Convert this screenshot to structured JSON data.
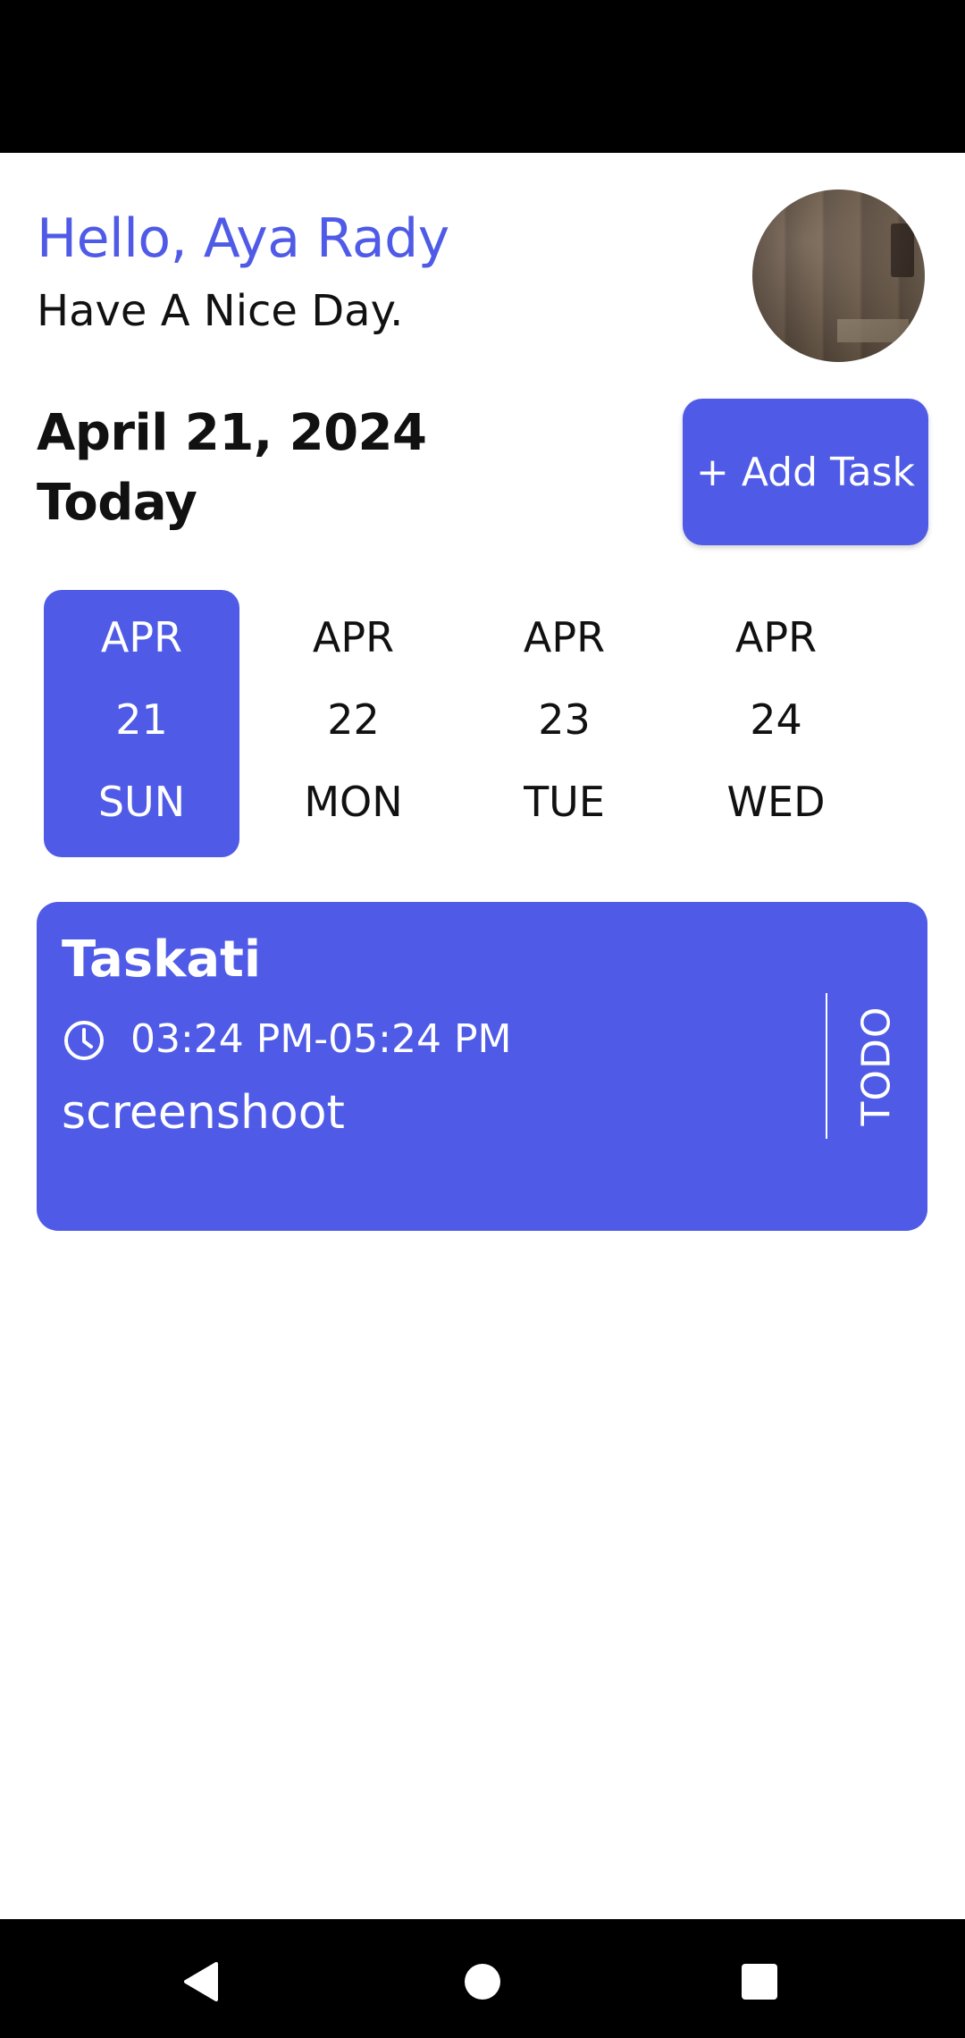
{
  "header": {
    "greeting": "Hello, Aya Rady",
    "subtitle": "Have A Nice Day."
  },
  "date_section": {
    "date": "April 21, 2024",
    "label": "Today",
    "add_task_label": "+ Add Task"
  },
  "days": [
    {
      "month": "APR",
      "day": "21",
      "weekday": "SUN",
      "selected": true
    },
    {
      "month": "APR",
      "day": "22",
      "weekday": "MON",
      "selected": false
    },
    {
      "month": "APR",
      "day": "23",
      "weekday": "TUE",
      "selected": false
    },
    {
      "month": "APR",
      "day": "24",
      "weekday": "WED",
      "selected": false
    }
  ],
  "task": {
    "title": "Taskati",
    "time": "03:24 PM-05:24 PM",
    "description": "screenshoot",
    "status": "TODO"
  },
  "colors": {
    "accent": "#4F5BE7",
    "text": "#111111",
    "background": "#FFFFFF"
  },
  "icons": {
    "task_time": "clock-icon",
    "nav": [
      "back-icon",
      "home-icon",
      "recents-icon"
    ]
  }
}
